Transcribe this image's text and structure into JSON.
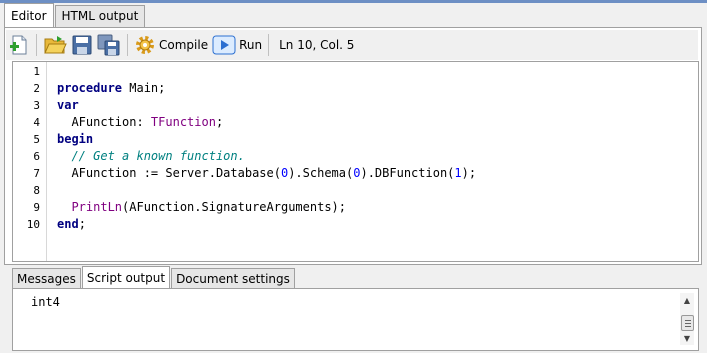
{
  "tabs_top": [
    "Editor",
    "HTML output"
  ],
  "toolbar": {
    "compile_label": "Compile",
    "run_label": "Run",
    "status": "Ln 10, Col. 5",
    "icons": [
      "new-file-icon",
      "open-folder-icon",
      "save-icon",
      "save-all-icon",
      "compile-gear-icon",
      "run-play-icon"
    ]
  },
  "editor": {
    "line_numbers": [
      "1",
      "2",
      "3",
      "4",
      "5",
      "6",
      "7",
      "8",
      "9",
      "10"
    ],
    "code": {
      "l2_kw": "procedure",
      "l2_rest": " Main;",
      "l3_kw": "var",
      "l4_a": "  AFunction: ",
      "l4_type": "TFunction",
      "l4_b": ";",
      "l5_kw": "begin",
      "l6_comment": "  // Get a known function.",
      "l7_a": "  AFunction := Server.Database(",
      "l7_n1": "0",
      "l7_b": ").Schema(",
      "l7_n2": "0",
      "l7_c": ").DBFunction(",
      "l7_n3": "1",
      "l7_d": ");",
      "l9_a": "  ",
      "l9_fn": "PrintLn",
      "l9_b": "(AFunction.SignatureArguments);",
      "l10_kw": "end",
      "l10_b": ";"
    }
  },
  "tabs_bottom": [
    "Messages",
    "Script output",
    "Document settings"
  ],
  "output": {
    "text": "int4"
  },
  "colors": {
    "keyword": "#000080",
    "type": "#800080",
    "comment": "#008080",
    "number": "#0000ff"
  }
}
